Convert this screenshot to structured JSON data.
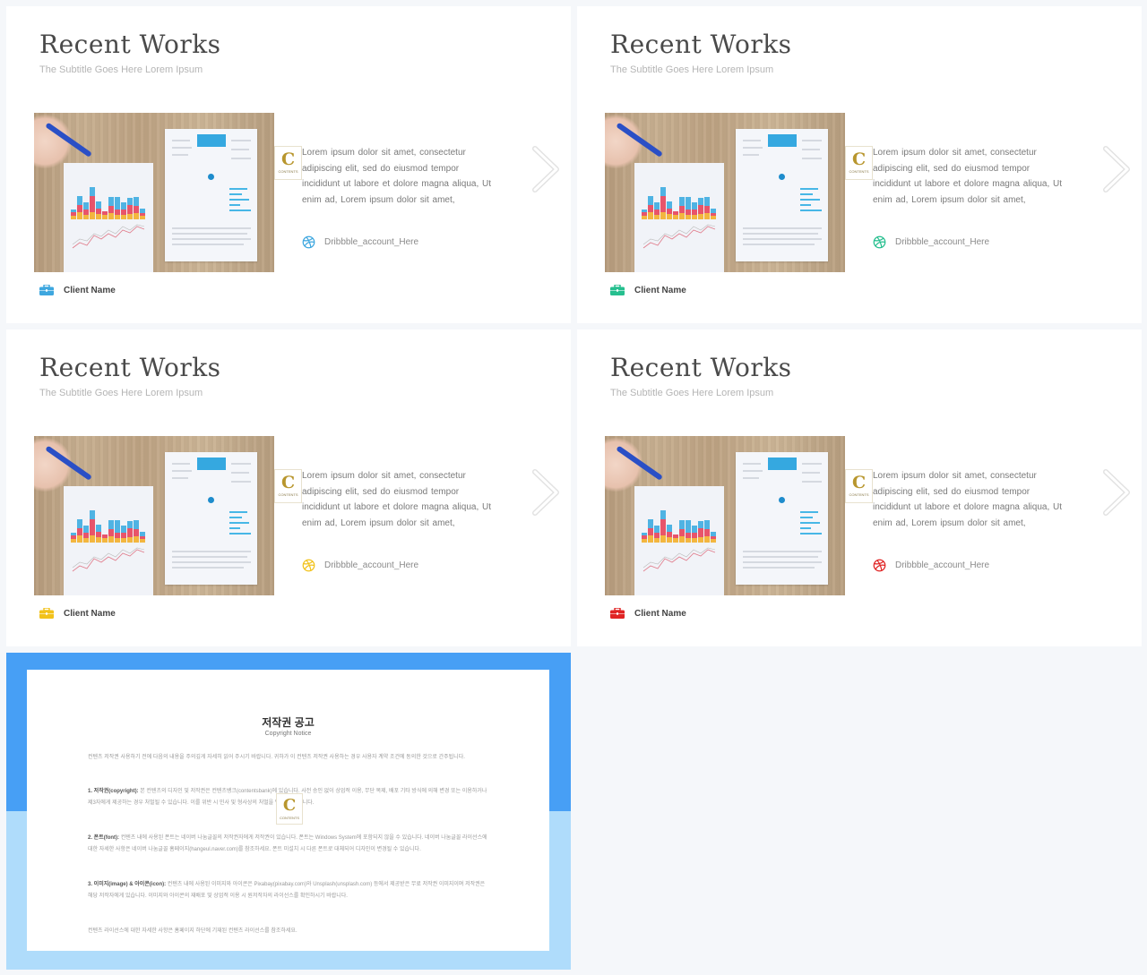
{
  "slides": [
    {
      "title": "Recent Works",
      "subtitle": "The Subtitle Goes Here Lorem Ipsum",
      "body": "Lorem ipsum dolor sit amet, consectetur adipiscing elit, sed do eiusmod tempor incididunt ut labore et dolore magna aliqua, Ut enim ad, Lorem ipsum dolor sit amet,",
      "dribbble": "Dribbble_account_Here",
      "client": "Client Name",
      "accent": "#3ea7df",
      "logo_letter": "C",
      "logo_text": "CONTENTS"
    },
    {
      "title": "Recent Works",
      "subtitle": "The Subtitle Goes Here Lorem Ipsum",
      "body": "Lorem ipsum dolor sit amet, consectetur adipiscing elit, sed do eiusmod tempor incididunt ut labore et dolore magna aliqua, Ut enim ad, Lorem ipsum dolor sit amet,",
      "dribbble": "Dribbble_account_Here",
      "client": "Client Name",
      "accent": "#26bf8f",
      "logo_letter": "C",
      "logo_text": "CONTENTS"
    },
    {
      "title": "Recent Works",
      "subtitle": "The Subtitle Goes Here Lorem Ipsum",
      "body": "Lorem ipsum dolor sit amet, consectetur adipiscing elit, sed do eiusmod tempor incididunt ut labore et dolore magna aliqua, Ut enim ad, Lorem ipsum dolor sit amet,",
      "dribbble": "Dribbble_account_Here",
      "client": "Client Name",
      "accent": "#f2c21b",
      "logo_letter": "C",
      "logo_text": "CONTENTS"
    },
    {
      "title": "Recent Works",
      "subtitle": "The Subtitle Goes Here Lorem Ipsum",
      "body": "Lorem ipsum dolor sit amet, consectetur adipiscing elit, sed do eiusmod tempor incididunt ut labore et dolore magna aliqua, Ut enim ad, Lorem ipsum dolor sit amet,",
      "dribbble": "Dribbble_account_Here",
      "client": "Client Name",
      "accent": "#e02424",
      "logo_letter": "C",
      "logo_text": "CONTENTS"
    }
  ],
  "copyright": {
    "title": "저작권 공고",
    "subtitle": "Copyright Notice",
    "intro": "컨텐츠 저작권 사용하기 전에 다음의 내용을 주의깊게 자세히 읽어 주시기 바랍니다. 귀하가 이 컨텐츠 저작권 사용하는 경우 사용자 계약 조건에 동의한 것으로 간주됩니다.",
    "sections": [
      {
        "heading": "1. 저작권(copyright):",
        "text": "본 컨텐츠의 디자인 및 저작권은 컨텐츠뱅크(contentsbank)에 있습니다. 사전 승인 없이 상업적 이용, 무단 복제, 배포 기타 방식에 의해 변경 또는 이용하거나 제3자에게 제공하는 경우 처벌될 수 있습니다. 이를 위반 시 민사 및 형사상의 처벌을 받을 수 있습니다."
      },
      {
        "heading": "2. 폰트(font):",
        "text": "컨텐츠 내에 사용된 폰트는 네이버 나눔글꼴의 저작권자에게 저작권이 있습니다. 폰트는 Windows System에 포함되지 않을 수 있습니다. 네이버 나눔글꼴 라이선스에 대한 자세한 사항은 네이버 나눔글꼴 홈페이지(hangeul.naver.com)를 참조하세요. 폰트 미설치 시 다른 폰트로 대체되어 디자인이 변경될 수 있습니다."
      },
      {
        "heading": "3. 이미지(image) & 아이콘(icon):",
        "text": "컨텐츠 내에 사용된 이미지와 아이콘은 Pixabay(pixabay.com)와 Unsplash(unsplash.com) 등에서 제공받은 무료 저작권 이미지이며 저작권은 해당 저작자에게 있습니다. 이미지와 아이콘의 재배포 및 상업적 이용 시 원저작자의 라이선스를 확인하시기 바랍니다."
      }
    ],
    "footer": "컨텐츠 라이선스에 대한 자세한 사항은 홈페이지 하단에 기재된 컨텐츠 라이선스를 참조하세요.",
    "logo_letter": "C",
    "logo_text": "CONTENTS"
  },
  "colors": {
    "copy_dark": "#479ff5",
    "copy_light": "#afdcfb",
    "background": "#f5f7fa"
  }
}
